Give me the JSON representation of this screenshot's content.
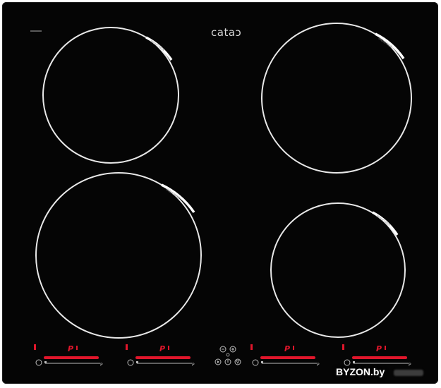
{
  "brand": {
    "logo_text": "cata"
  },
  "zones": [
    {
      "id": "rear-left"
    },
    {
      "id": "front-left"
    },
    {
      "id": "rear-right"
    },
    {
      "id": "front-right"
    }
  ],
  "controls": {
    "power_symbol": "P",
    "slider_end_label": "P",
    "zone_panels": [
      {
        "id": "front-left-panel"
      },
      {
        "id": "rear-left-panel"
      },
      {
        "id": "rear-right-panel"
      },
      {
        "id": "front-right-panel"
      }
    ],
    "center_buttons": [
      "minus-button",
      "plus-button",
      "play-button",
      "power-button",
      "lock-button"
    ]
  },
  "watermark": {
    "text": "BYZON.by"
  },
  "colors": {
    "glass": "#050505",
    "ring": "#e8e8e8",
    "display_red": "#e0162b",
    "icon_grey": "#bdbdbd"
  }
}
